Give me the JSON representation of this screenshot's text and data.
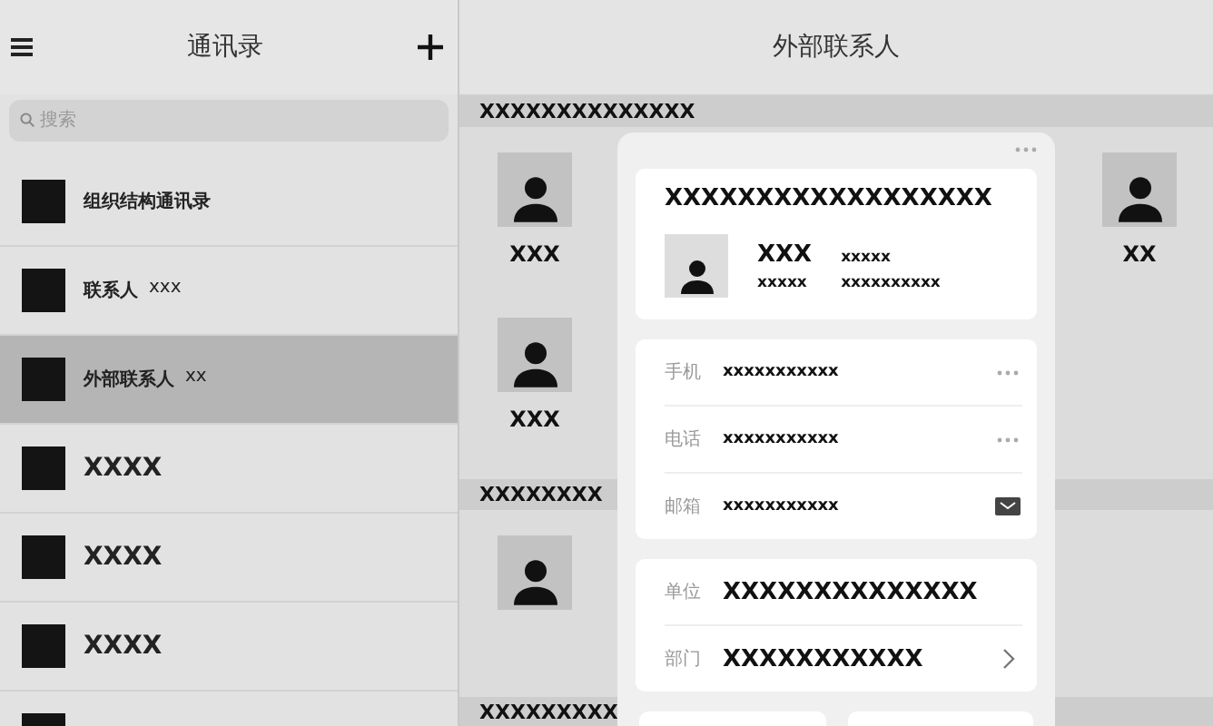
{
  "sidebar": {
    "title": "通讯录",
    "search": {
      "placeholder": "搜索"
    },
    "items": [
      {
        "label": "组织结构通讯录",
        "selected": false,
        "kind": "small"
      },
      {
        "label": "联系人",
        "count": "xxx",
        "selected": false,
        "kind": "small"
      },
      {
        "label": "外部联系人",
        "count": "xx",
        "selected": true,
        "kind": "small"
      },
      {
        "label": "XXXX",
        "selected": false,
        "kind": "large"
      },
      {
        "label": "XXXX",
        "selected": false,
        "kind": "large"
      },
      {
        "label": "XXXX",
        "selected": false,
        "kind": "large"
      },
      {
        "selected": false,
        "kind": "large"
      }
    ]
  },
  "main": {
    "title": "外部联系人",
    "sections": [
      {
        "title": "XXXXXXXXXXXXXX",
        "rows": [
          [
            {
              "name": "XXX"
            },
            {
              "name": "XX"
            }
          ],
          [
            {
              "name": "XXX"
            }
          ]
        ]
      },
      {
        "title": "XXXXXXXX",
        "rows": [
          [
            {}
          ]
        ]
      },
      {
        "title": "XXXXXXXXX"
      }
    ]
  },
  "popup": {
    "company": "XXXXXXXXXXXXXXXXXX",
    "name": "XXX",
    "tag": "xxxxx",
    "line_1": "xxxxx",
    "line_2": "xxxxxxxxxx",
    "fields": [
      {
        "label": "手机",
        "value": "xxxxxxxxxxx",
        "kind": "more"
      },
      {
        "label": "电话",
        "value": "xxxxxxxxxxx",
        "kind": "more"
      },
      {
        "label": "邮箱",
        "value": "xxxxxxxxxxx",
        "kind": "mail"
      }
    ],
    "org": [
      {
        "label": "单位",
        "value": "XXXXXXXXXXXXXX",
        "kind": "none"
      },
      {
        "label": "部门",
        "value": "XXXXXXXXXXX",
        "kind": "chevron"
      }
    ]
  }
}
